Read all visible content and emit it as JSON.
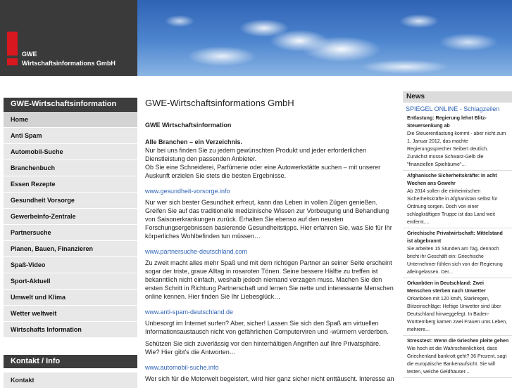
{
  "header": {
    "company_line1": "GWE",
    "company_line2": "Wirtschaftsinformations GmbH"
  },
  "nav": {
    "heading": "GWE-Wirtschaftsinformation",
    "items": [
      {
        "label": "Home",
        "active": true
      },
      {
        "label": "Anti Spam"
      },
      {
        "label": "Automobil-Suche"
      },
      {
        "label": "Branchenbuch"
      },
      {
        "label": "Essen Rezepte"
      },
      {
        "label": "Gesundheit Vorsorge"
      },
      {
        "label": "Gewerbeinfo-Zentrale"
      },
      {
        "label": "Partnersuche"
      },
      {
        "label": "Planen, Bauen, Finanzieren"
      },
      {
        "label": "Spaß-Video"
      },
      {
        "label": "Sport-Aktuell"
      },
      {
        "label": "Umwelt und Klima"
      },
      {
        "label": "Wetter weltweit"
      },
      {
        "label": "Wirtschafts Information"
      }
    ],
    "contact_heading": "Kontakt / Info",
    "contact_item": "Kontakt"
  },
  "main": {
    "title": "GWE-Wirtschaftsinformations GmbH",
    "company": "GWE Wirtschaftsinformation",
    "lead": "Alle Branchen – ein Verzeichnis.",
    "intro1": "Nur bei uns finden Sie zu jedem gewünschten Produkt und jeder erforderlichen Dienstleistung den passenden Anbieter.",
    "intro2": "Ob Sie eine Schneiderei, Parfümerie oder eine Autowerkstätte suchen – mit unserer Auskunft erzielen Sie stets die besten Ergebnisse.",
    "sections": [
      {
        "link": "www.gesundheit-vorsorge.info",
        "text": "Nur wer sich bester Gesundheit erfreut, kann das Leben in vollen Zügen genießen. Greifen Sie auf das traditionelle medizinische Wissen zur Vorbeugung und Behandlung von Saisonerkrankungen zurück. Erhalten Sie ebenso auf den neusten Forschungsergebnissen basierende Gesundheitstipps. Hier erfahren Sie, was Sie für Ihr körperliches Wohlbefinden tun müssen…"
      },
      {
        "link": "www.partnersuche-deutschland.com",
        "text": "Zu zweit macht alles mehr Spaß und mit dem richtigen Partner an seiner Seite erscheint sogar der triste, graue Alltag in rosaroten Tönen. Seine bessere Hälfte zu treffen ist bekanntlich nicht einfach, weshalb jedoch niemand verzagen muss. Machen Sie den ersten Schritt in Richtung Partnerschaft und lernen Sie nette und interessante Menschen online kennen. Hier finden Sie Ihr Liebesglück…"
      },
      {
        "link": "www.anti-spam-deutschland.de",
        "text": "Unbesorgt im Internet surfen? Aber, sicher! Lassen Sie sich den Spaß am virtuellen Informationsaustausch nicht von gefährlichen Computerviren und -würmern verderben.",
        "text2": "Schützen Sie sich zuverlässig vor den hinterhältigen Angriffen auf Ihre Privatsphäre. Wie? Hier gibt's die Antworten…"
      },
      {
        "link": "www.automobil-suche.info",
        "text": "Wer sich für die Motorwelt begeistert, wird hier ganz sicher nicht enttäuscht. Interesse an"
      }
    ]
  },
  "news": {
    "title": "News",
    "source": "SPIEGEL ONLINE - Schlagzeilen",
    "items": [
      {
        "headline": "Entlastung: Regierung lehnt Blitz-Steuersenkung ab",
        "text": "Die Steuerentlastung kommt - aber nicht zum 1. Januar 2012, das machte Regierungssprecher Seibert deutlich. Zunächst müsse Schwarz-Gelb die \"finanziellen Spielräume\"..."
      },
      {
        "headline": "Afghanische Sicherheitskräfte: In acht Wochen ans Gewehr",
        "text": "Ab 2014 sollen die einheimischen Sicherheitskräfte in Afghanistan selbst für Ordnung sorgen. Doch von einer schlagkräftigen Truppe ist das Land weit entfernt...."
      },
      {
        "headline": "Griechische Privatwirtschaft: Mittelstand ist abgebrannt",
        "text": "Sie arbeiten 15 Stunden am Tag, dennoch bricht ihr Geschäft ein: Griechische Unternehmer fühlen sich von der Regierung alleingelassen. Der..."
      },
      {
        "headline": "Orkanböen in Deutschland: Zwei Menschen sterben nach Unwetter",
        "text": "Orkanböen mit 120 km/h, Starkregen, Blitzeinschläge: Heftige Unwetter sind über Deutschland hinweggefegt. In Baden-Württemberg kamen zwei Frauen ums Leben, mehrere..."
      },
      {
        "headline": "Stresstest: Wenn die Griechen pleite gehen",
        "text": "Wie hoch ist die Wahrscheinlichkeit, dass Griechenland bankrott geht? 36 Prozent, sagt die europäische Bankenaufsicht. Sie will testen, welche Geldhäuser..."
      }
    ]
  }
}
